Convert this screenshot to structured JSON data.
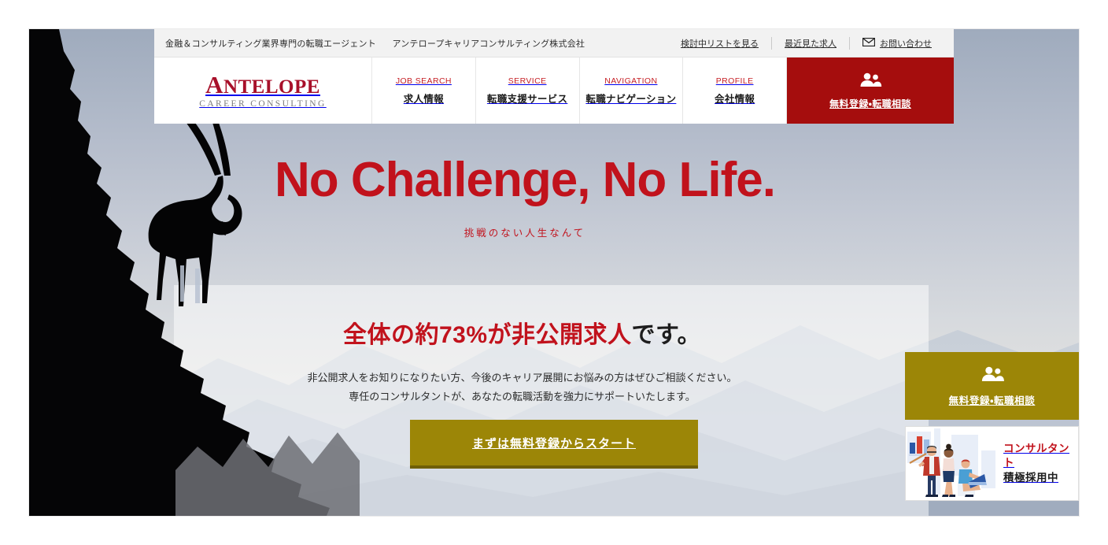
{
  "utility_bar": {
    "tagline": "金融＆コンサルティング業界専門の転職エージェント",
    "company": "アンテロープキャリアコンサルティング株式会社",
    "links": [
      {
        "label": "検討中リストを見る",
        "icon": ""
      },
      {
        "label": "最近見た求人",
        "icon": ""
      },
      {
        "label": "お問い合わせ",
        "icon": "mail-icon"
      }
    ]
  },
  "logo": {
    "name_first_letter": "A",
    "name_rest": "NTELOPE",
    "subtitle": "CAREER CONSULTING"
  },
  "nav": {
    "items": [
      {
        "en": "JOB SEARCH",
        "ja": "求人情報"
      },
      {
        "en": "SERVICE",
        "ja": "転職支援サービス"
      },
      {
        "en": "NAVIGATION",
        "ja": "転職ナビゲーション"
      },
      {
        "en": "PROFILE",
        "ja": "会社情報"
      }
    ],
    "cta": {
      "label": "無料登録・転職相談",
      "icon": "people-icon",
      "bg_color": "#a50d0d"
    }
  },
  "hero": {
    "headline": "No Challenge, No Life.",
    "subhead": "挑戦のない人生なんて",
    "headline_color": "#c1121c",
    "illustration": "ibex-on-cliff-silhouette"
  },
  "promo": {
    "title_red": "全体の約73%が非公開求人",
    "title_dark": "です。",
    "body_line1": "非公開求人をお知りになりたい方、今後のキャリア展開にお悩みの方はぜひご相談ください。",
    "body_line2": "専任のコンサルタントが、あなたの転職活動を強力にサポートいたします。",
    "button_label": "まずは無料登録からスタート",
    "button_color": "#9c8607"
  },
  "rail": {
    "cta": {
      "label": "無料登録・転職相談",
      "icon": "people-icon",
      "bg_color": "#9c8607"
    },
    "card": {
      "line1": "コンサルタント",
      "line2": "積極採用中",
      "illustration": "team-presentation-illustration"
    }
  }
}
